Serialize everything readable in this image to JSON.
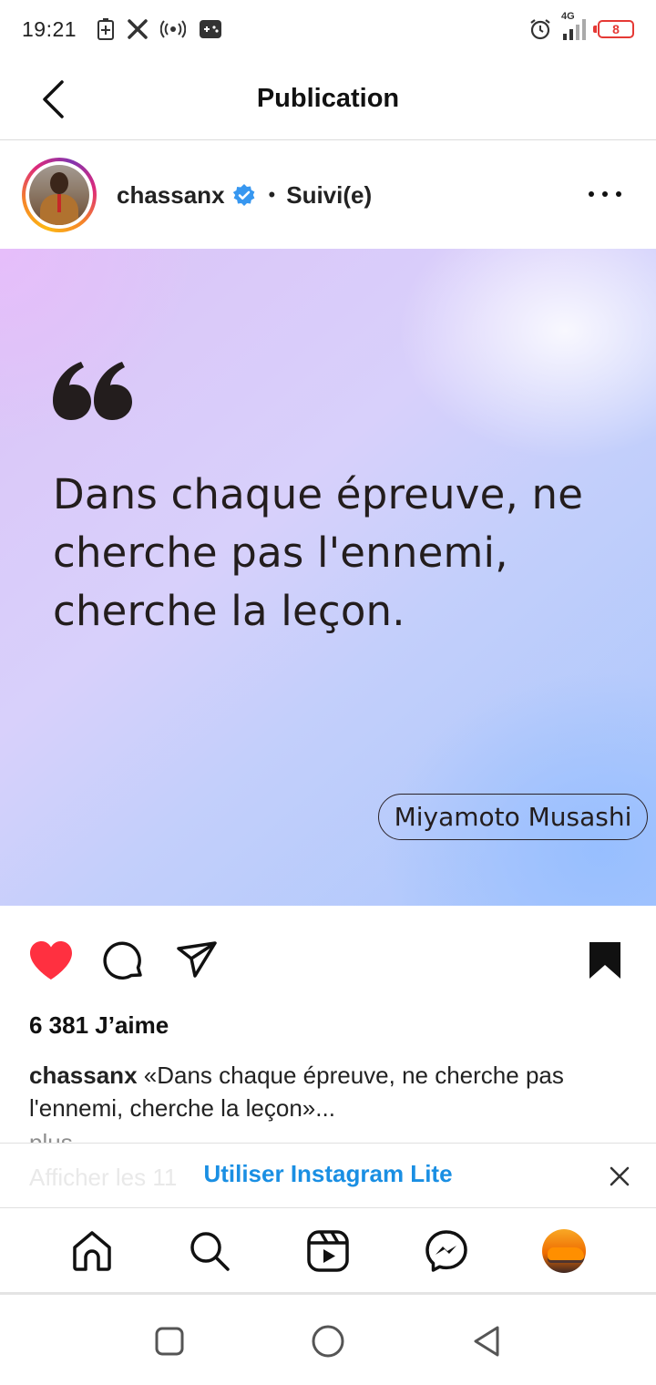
{
  "status_bar": {
    "time": "19:21",
    "network": "4G",
    "battery_level": "8",
    "icons": [
      "battery-saver-icon",
      "x-app-icon",
      "hotspot-icon",
      "game-controller-icon",
      "alarm-icon",
      "signal-icon",
      "battery-icon"
    ]
  },
  "header": {
    "title": "Publication",
    "back_icon": "chevron-left-icon"
  },
  "post": {
    "username": "chassanx",
    "verified": true,
    "separator": "•",
    "follow_status": "Suivi(e)",
    "more_icon": "more-horizontal-icon",
    "image": {
      "quote": "Dans chaque épreuve, ne cherche pas l'ennemi, cherche la leçon.",
      "author": "Miyamoto Musashi"
    },
    "liked": true,
    "saved": true,
    "likes_text": "6 381 J’aime",
    "caption_user": "chassanx",
    "caption_text": "«Dans chaque épreuve, ne cherche pas l'ennemi, cherche la leçon»...",
    "more_label": "plus",
    "comments_link_partial": "Afficher les 11"
  },
  "lite_banner": {
    "label": "Utiliser Instagram Lite",
    "close_icon": "close-icon"
  },
  "bottom_nav": {
    "items": [
      "home-icon",
      "search-icon",
      "reels-icon",
      "messenger-icon",
      "profile-avatar"
    ]
  },
  "system_nav": {
    "items": [
      "recent-apps-icon",
      "home-circle-icon",
      "back-triangle-icon"
    ]
  },
  "colors": {
    "like_red": "#ff3040",
    "link_blue": "#1a8fe3",
    "verified_blue": "#3797f0",
    "battery_red": "#e53935"
  }
}
